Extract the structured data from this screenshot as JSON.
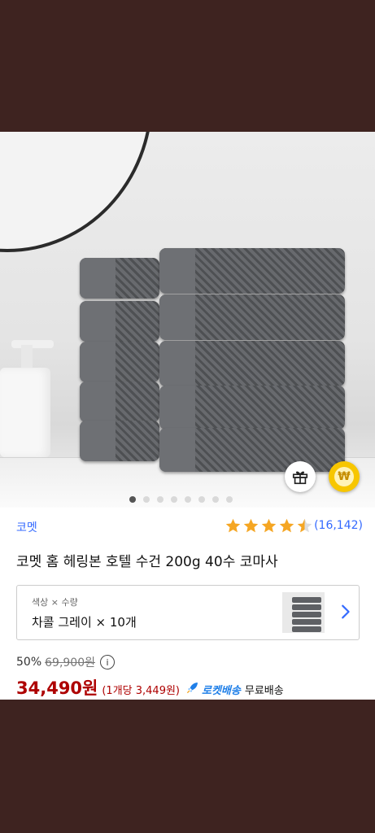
{
  "product": {
    "brand": "코멧",
    "rating": 4.5,
    "review_count": "(16,142)",
    "title": "코멧 홈 헤링본 호텔 수건 200g 40수 코마사"
  },
  "gallery": {
    "total_images": 8,
    "active_index": 0
  },
  "option": {
    "label": "색상 × 수량",
    "value": "차콜 그레이 × 10개"
  },
  "price": {
    "discount": "50%",
    "original": "69,900원",
    "info_glyph": "i",
    "sale": "34,490원",
    "unit": "(1개당 3,449원)",
    "rocket_label": "로켓배송",
    "shipping": "무료배송"
  },
  "icons": {
    "gift": "gift-icon",
    "won": "won-coin-icon",
    "won_glyph": "₩",
    "chevron": "chevron-right-icon",
    "rocket": "rocket-icon"
  },
  "colors": {
    "link": "#346aff",
    "sale": "#ae0000",
    "star": "#f5a623",
    "rocket": "#1f7fe8",
    "backdrop": "#3e2320"
  }
}
